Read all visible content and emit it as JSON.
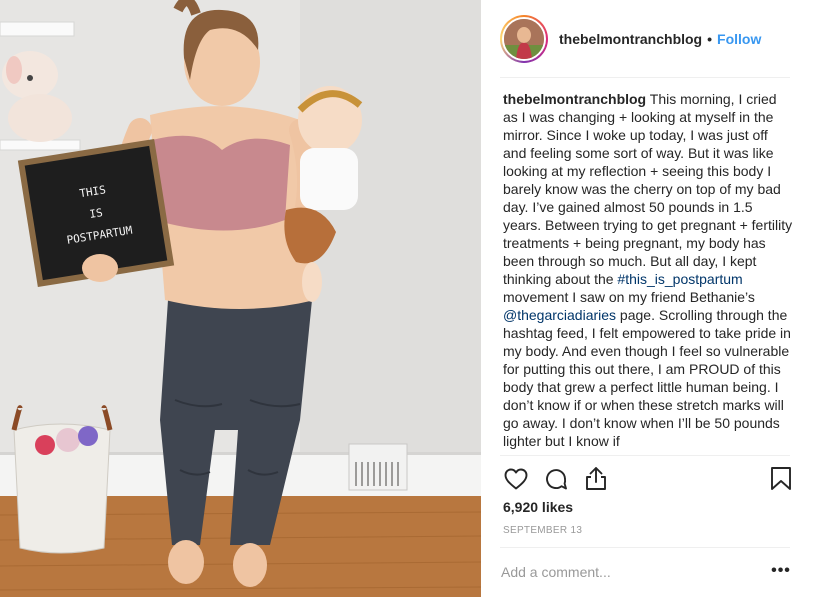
{
  "post": {
    "photo_icon": "postpartum-photo",
    "sign_lines": [
      "THIS",
      "IS",
      "POSTPARTUM"
    ]
  },
  "header": {
    "username": "thebelmontranchblog",
    "separator": "•",
    "follow_label": "Follow",
    "avatar_icon": "profile-avatar"
  },
  "caption": {
    "username": "thebelmontranchblog",
    "text_1": " This morning, I cried as I was changing + looking at myself in the mirror. Since I woke up today, I was just off and feeling some sort of way. But it was like looking at my reflection + seeing this body I barely know was the cherry on top of my bad day. I’ve gained almost 50 pounds in 1.5 years. Between trying to get pregnant + fertility treatments + being pregnant, my body has been through so much. But all day, I kept thinking about the ",
    "hashtag": "#this_is_postpartum",
    "text_2": " movement I saw on my friend Bethanie’s ",
    "mention": "@thegarciadiaries",
    "text_3": " page. Scrolling through the hashtag feed, I felt empowered to take pride in my body. And even though I feel so vulnerable for putting this out there, I am PROUD of this body that grew a perfect little human being. I don’t know if or when these stretch marks will go away. I don’t know when I’ll be 50 pounds lighter but I know if"
  },
  "actions": {
    "like_icon": "heart-icon",
    "comment_icon": "comment-icon",
    "share_icon": "share-icon",
    "save_icon": "bookmark-icon"
  },
  "likes_text": "6,920 likes",
  "date_text": "SEPTEMBER 13",
  "comment": {
    "placeholder": "Add a comment...",
    "more_label": "•••"
  },
  "colors": {
    "follow": "#3897f0",
    "link": "#003569",
    "muted": "#999999",
    "divider": "#efefef"
  }
}
